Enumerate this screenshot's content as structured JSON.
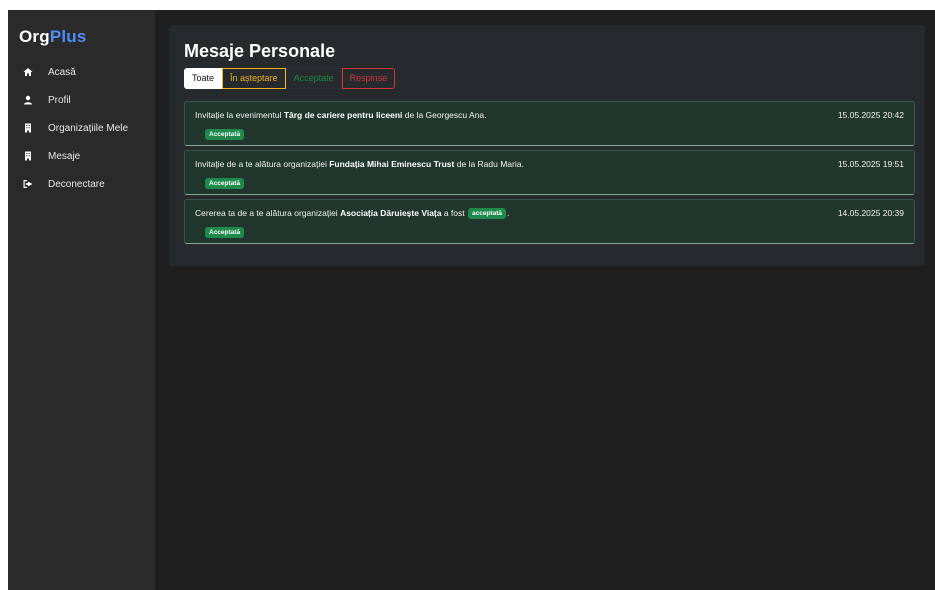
{
  "brand": {
    "part1": "Org",
    "part2": "Plus"
  },
  "sidebar": {
    "items": [
      {
        "label": "Acasă",
        "icon": "home-icon"
      },
      {
        "label": "Profil",
        "icon": "user-icon"
      },
      {
        "label": "Organizațiile Mele",
        "icon": "building-icon"
      },
      {
        "label": "Mesaje",
        "icon": "building-icon"
      },
      {
        "label": "Deconectare",
        "icon": "sign-out-icon"
      }
    ]
  },
  "main": {
    "title": "Mesaje Personale",
    "tabs": [
      {
        "label": "Toate",
        "active": true
      },
      {
        "label": "În așteptare"
      },
      {
        "label": "Acceptate"
      },
      {
        "label": "Respinse"
      }
    ],
    "messages": [
      {
        "prefix": "Invitație la evenimentul ",
        "bold": "Târg de cariere pentru liceeni",
        "suffix": " de la Georgescu Ana.",
        "date": "15.05.2025 20:42",
        "status": "Acceptată"
      },
      {
        "prefix": "Invitație de a te alătura organizației ",
        "bold": "Fundația Mihai Eminescu Trust",
        "suffix": " de la Radu Maria.",
        "date": "15.05.2025 19:51",
        "status": "Acceptată"
      },
      {
        "prefix": "Cererea ta de a te alătura organizației ",
        "bold": "Asociația Dăruiește Viața",
        "middle": " a fost ",
        "inline_badge": "acceptată",
        "suffix": ".",
        "date": "14.05.2025 20:39",
        "status": "Acceptată"
      }
    ]
  },
  "colors": {
    "accent": "#4f8ef7",
    "pending": "#f2b31b",
    "accepted": "#1f8a4c",
    "rejected": "#d3363e"
  }
}
